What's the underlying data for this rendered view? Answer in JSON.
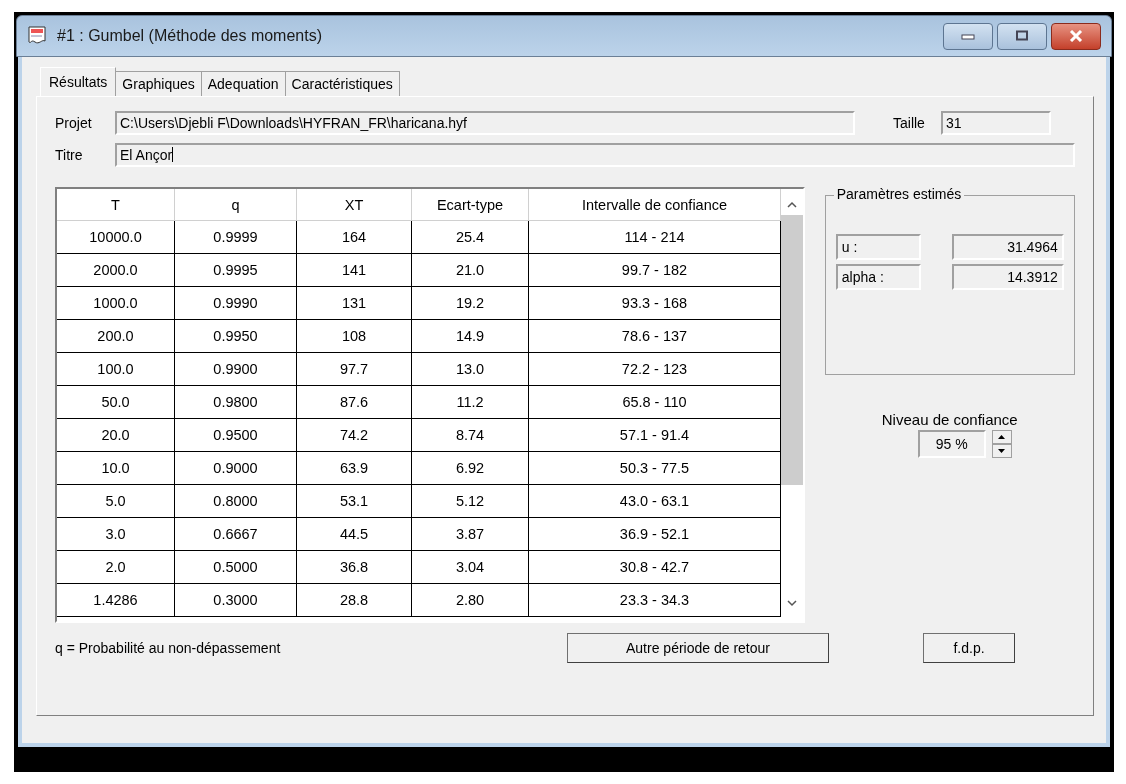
{
  "window": {
    "title": "#1 : Gumbel (Méthode des moments)"
  },
  "tabs": [
    {
      "label": "Résultats",
      "selected": true
    },
    {
      "label": "Graphiques",
      "selected": false
    },
    {
      "label": "Adequation",
      "selected": false
    },
    {
      "label": "Caractéristiques",
      "selected": false
    }
  ],
  "project": {
    "label": "Projet",
    "value": "C:\\Users\\Djebli F\\Downloads\\HYFRAN_FR\\haricana.hyf"
  },
  "size": {
    "label": "Taille",
    "value": "31"
  },
  "title_field": {
    "label": "Titre",
    "value": "El Ançor"
  },
  "table": {
    "columns": [
      "T",
      "q",
      "XT",
      "Ecart-type",
      "Intervalle de confiance"
    ],
    "rows": [
      [
        "10000.0",
        "0.9999",
        "164",
        "25.4",
        "114 - 214"
      ],
      [
        "2000.0",
        "0.9995",
        "141",
        "21.0",
        "99.7 - 182"
      ],
      [
        "1000.0",
        "0.9990",
        "131",
        "19.2",
        "93.3 - 168"
      ],
      [
        "200.0",
        "0.9950",
        "108",
        "14.9",
        "78.6 - 137"
      ],
      [
        "100.0",
        "0.9900",
        "97.7",
        "13.0",
        "72.2 - 123"
      ],
      [
        "50.0",
        "0.9800",
        "87.6",
        "11.2",
        "65.8 - 110"
      ],
      [
        "20.0",
        "0.9500",
        "74.2",
        "8.74",
        "57.1 - 91.4"
      ],
      [
        "10.0",
        "0.9000",
        "63.9",
        "6.92",
        "50.3 - 77.5"
      ],
      [
        "5.0",
        "0.8000",
        "53.1",
        "5.12",
        "43.0 - 63.1"
      ],
      [
        "3.0",
        "0.6667",
        "44.5",
        "3.87",
        "36.9 - 52.1"
      ],
      [
        "2.0",
        "0.5000",
        "36.8",
        "3.04",
        "30.8 - 42.7"
      ],
      [
        "1.4286",
        "0.3000",
        "28.8",
        "2.80",
        "23.3 - 34.3"
      ]
    ]
  },
  "parameters": {
    "title": "Paramètres estimés",
    "items": [
      {
        "name": "u :",
        "value": "31.4964"
      },
      {
        "name": "alpha :",
        "value": "14.3912"
      }
    ]
  },
  "confidence": {
    "label": "Niveau de confiance",
    "value": "95 %"
  },
  "footnote": "q = Probabilité au non-dépassement",
  "buttons": [
    "Autre période de retour",
    "f.d.p."
  ]
}
